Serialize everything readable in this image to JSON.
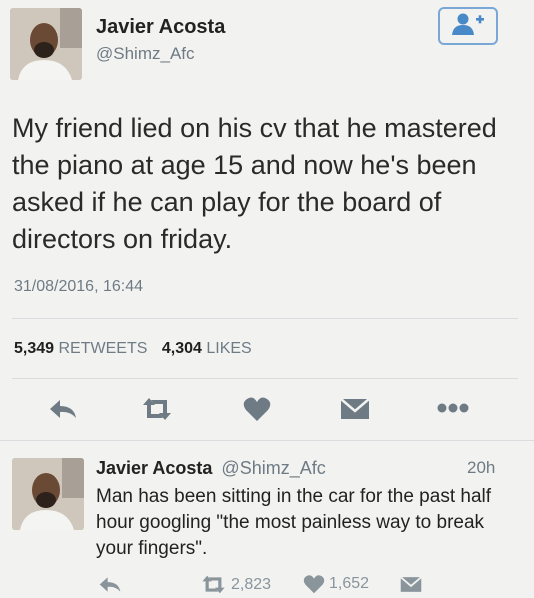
{
  "tweet": {
    "author_name": "Javier Acosta",
    "author_handle": "@Shimz_Afc",
    "text": "My friend lied on his cv that he mastered the piano at age 15 and now he's been asked if he can  play for the board of directors on friday.",
    "timestamp": "31/08/2016, 16:44",
    "retweets": "5,349",
    "retweets_label": "RETWEETS",
    "likes": "4,304",
    "likes_label": "LIKES"
  },
  "reply": {
    "author_name": "Javier Acosta",
    "author_handle": "@Shimz_Afc",
    "time": "20h",
    "text": "Man has been sitting in the car for the past half hour googling \"the most painless way to break your fingers\".",
    "retweets": "2,823",
    "likes": "1,652"
  },
  "icons": {
    "follow": "add-user-icon",
    "reply": "reply-icon",
    "retweet": "retweet-icon",
    "like": "heart-icon",
    "dm": "envelope-icon",
    "more": "more-icon"
  },
  "colors": {
    "background": "#f2f3f1",
    "action_icon": "#6f7b84",
    "follow_accent": "#4a89c8",
    "secondary_text": "#6f7b84"
  }
}
